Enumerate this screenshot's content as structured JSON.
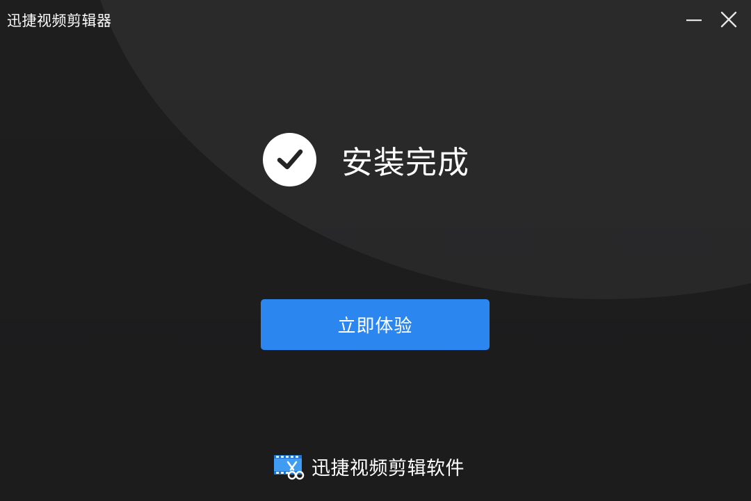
{
  "window": {
    "title": "迅捷视频剪辑器",
    "minimize_icon": "minimize-icon",
    "close_icon": "close-icon"
  },
  "main": {
    "status_icon": "check-circle-icon",
    "status_text": "安装完成",
    "primary_button_label": "立即体验"
  },
  "footer": {
    "brand_logo_icon": "video-editor-logo-icon",
    "brand_name": "迅捷视频剪辑软件"
  },
  "colors": {
    "background": "#1e1e1f",
    "accent": "#2b86f0",
    "text": "#ffffff"
  }
}
